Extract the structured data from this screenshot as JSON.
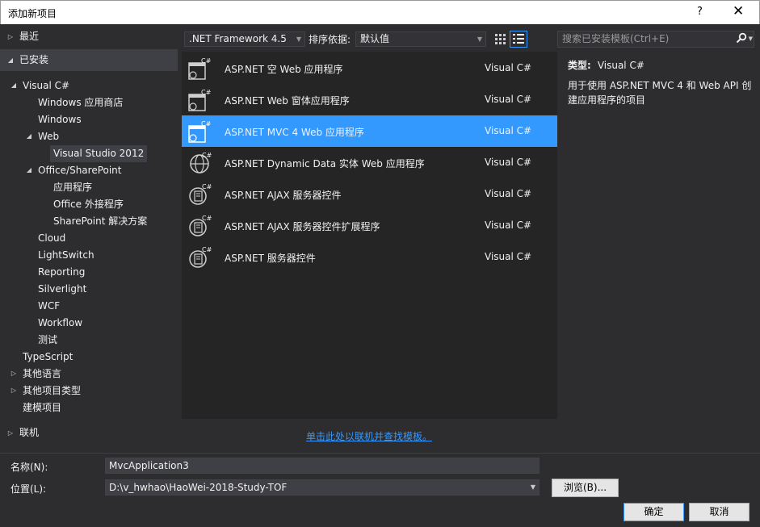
{
  "window": {
    "title": "添加新项目",
    "help": "?",
    "close": "✕"
  },
  "tree": {
    "recent": "最近",
    "installed": "已安装",
    "visual_csharp": "Visual C#",
    "windows_store": "Windows 应用商店",
    "windows": "Windows",
    "web": "Web",
    "vs2012": "Visual Studio 2012",
    "office_sharepoint": "Office/SharePoint",
    "apps": "应用程序",
    "office_addins": "Office 外接程序",
    "sharepoint_solutions": "SharePoint 解决方案",
    "cloud": "Cloud",
    "lightswitch": "LightSwitch",
    "reporting": "Reporting",
    "silverlight": "Silverlight",
    "wcf": "WCF",
    "workflow": "Workflow",
    "test": "测试",
    "typescript": "TypeScript",
    "other_languages": "其他语言",
    "other_project_types": "其他项目类型",
    "modeling_projects": "建模项目",
    "online": "联机"
  },
  "toolbar": {
    "framework": ".NET Framework 4.5",
    "sort_label": "排序依据:",
    "sort_value": "默认值",
    "search_placeholder": "搜索已安装模板(Ctrl+E)"
  },
  "templates": [
    {
      "name": "ASP.NET 空 Web 应用程序",
      "lang": "Visual C#",
      "icon": "empty-web-app-icon"
    },
    {
      "name": "ASP.NET Web 窗体应用程序",
      "lang": "Visual C#",
      "icon": "webforms-app-icon"
    },
    {
      "name": "ASP.NET MVC 4 Web 应用程序",
      "lang": "Visual C#",
      "icon": "mvc-app-icon"
    },
    {
      "name": "ASP.NET Dynamic Data 实体 Web 应用程序",
      "lang": "Visual C#",
      "icon": "dynamic-data-icon"
    },
    {
      "name": "ASP.NET AJAX 服务器控件",
      "lang": "Visual C#",
      "icon": "ajax-server-control-icon"
    },
    {
      "name": "ASP.NET AJAX 服务器控件扩展程序",
      "lang": "Visual C#",
      "icon": "ajax-extender-icon"
    },
    {
      "name": "ASP.NET 服务器控件",
      "lang": "Visual C#",
      "icon": "server-control-icon"
    }
  ],
  "description": {
    "type_label": "类型:",
    "type_value": "Visual C#",
    "text": "用于使用 ASP.NET MVC 4 和 Web API 创建应用程序的项目"
  },
  "online_link": "单击此处以联机并查找模板。",
  "form": {
    "name_label": "名称(N):",
    "name_value": "MvcApplication3",
    "location_label": "位置(L):",
    "location_value": "D:\\v_hwhao\\HaoWei-2018-Study-TOF",
    "browse": "浏览(B)...",
    "ok": "确定",
    "cancel": "取消"
  },
  "colors": {
    "accent": "#3399ff",
    "background": "#2d2d30",
    "list_bg": "#252526"
  }
}
